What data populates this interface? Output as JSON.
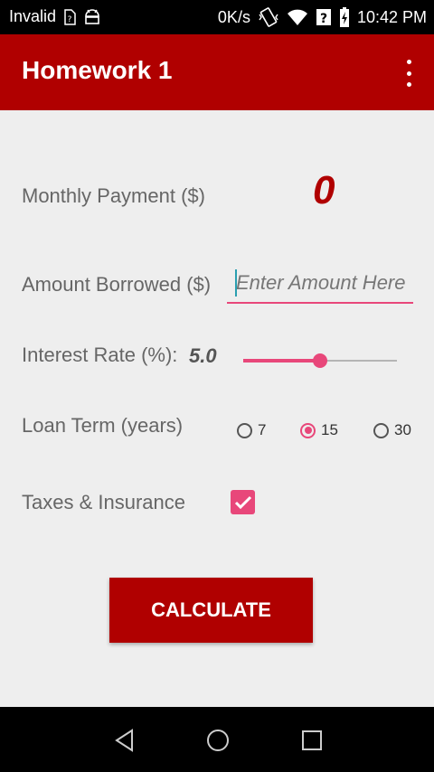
{
  "status_bar": {
    "carrier": "Invalid",
    "network_speed": "0K/s",
    "time": "10:42 PM",
    "icons": [
      "sim-unknown-icon",
      "android-debug-icon",
      "vibrate-icon",
      "wifi-icon",
      "signal-unknown-icon",
      "battery-charging-icon"
    ]
  },
  "app_bar": {
    "title": "Homework 1",
    "menu_icon": "overflow-menu-icon"
  },
  "form": {
    "monthly_payment": {
      "label": "Monthly Payment ($)",
      "value": "0"
    },
    "amount_borrowed": {
      "label": "Amount Borrowed ($)",
      "value": "",
      "placeholder": "Enter Amount Here"
    },
    "interest_rate": {
      "label": "Interest Rate (%):",
      "value": "5.0",
      "slider_fraction": 0.5
    },
    "loan_term": {
      "label": "Loan Term (years)",
      "options": [
        "7",
        "15",
        "30"
      ],
      "selected": "15"
    },
    "taxes_insurance": {
      "label": "Taxes & Insurance",
      "checked": true
    },
    "calculate_button": "CALCULATE"
  },
  "colors": {
    "primary": "#b00000",
    "accent": "#e8477a",
    "background": "#eeeeee"
  },
  "nav_bar": {
    "icons": [
      "back-icon",
      "home-icon",
      "recents-icon"
    ]
  }
}
